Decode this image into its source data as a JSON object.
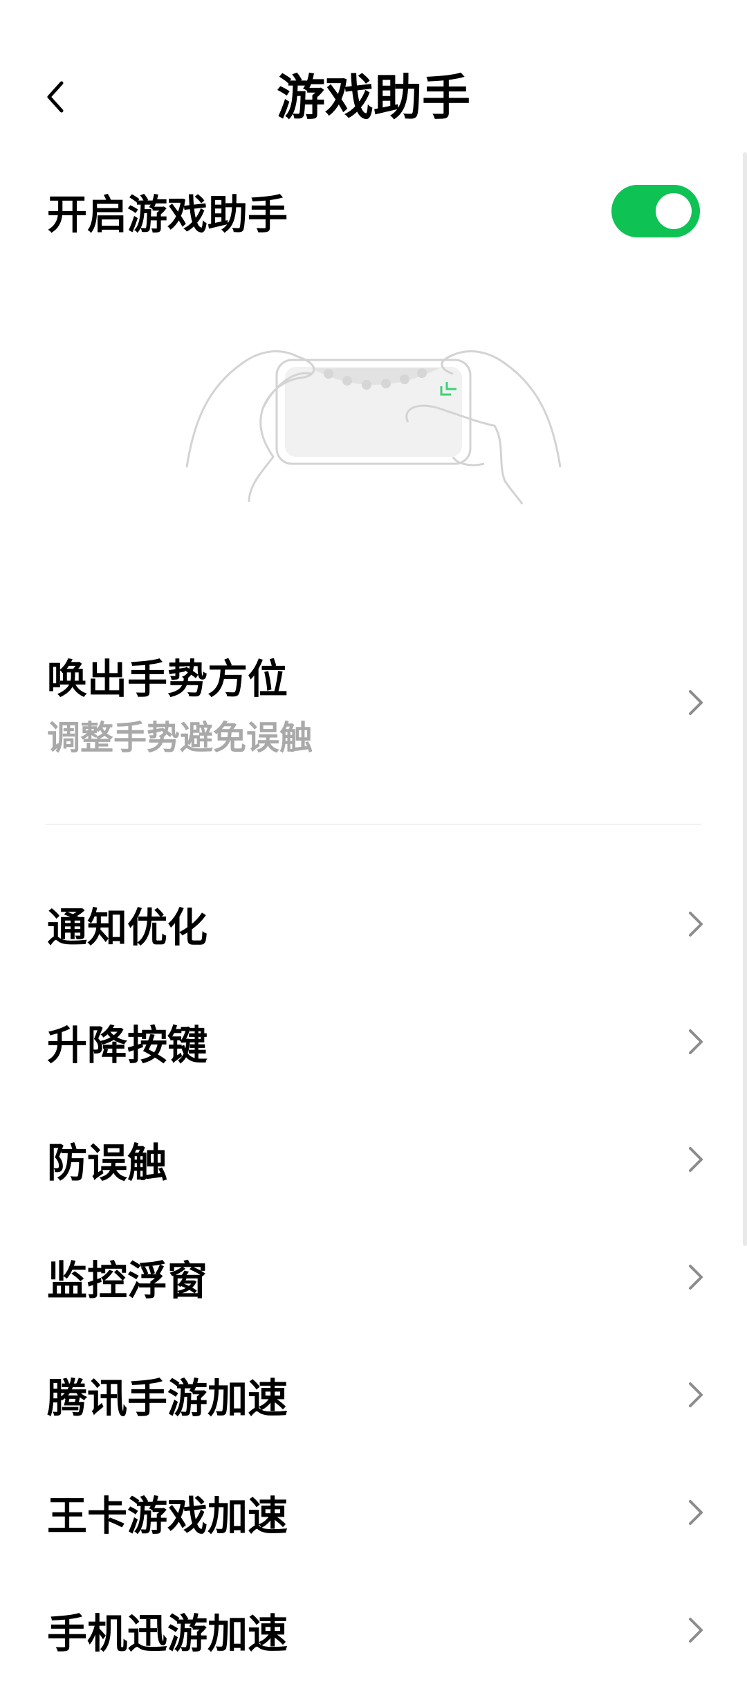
{
  "header": {
    "title": "游戏助手",
    "back_icon": "chevron-left-icon"
  },
  "toggle": {
    "label": "开启游戏助手",
    "enabled": true
  },
  "gesture": {
    "title": "唤出手势方位",
    "subtitle": "调整手势避免误触"
  },
  "menu": {
    "items": [
      {
        "label": "通知优化"
      },
      {
        "label": "升降按键"
      },
      {
        "label": "防误触"
      },
      {
        "label": "监控浮窗"
      },
      {
        "label": "腾讯手游加速"
      },
      {
        "label": "王卡游戏加速"
      },
      {
        "label": "手机迅游加速"
      }
    ]
  },
  "colors": {
    "accent": "#0ec254",
    "illustration_line": "#d3d3d3",
    "illustration_accent": "#3ed07a"
  }
}
